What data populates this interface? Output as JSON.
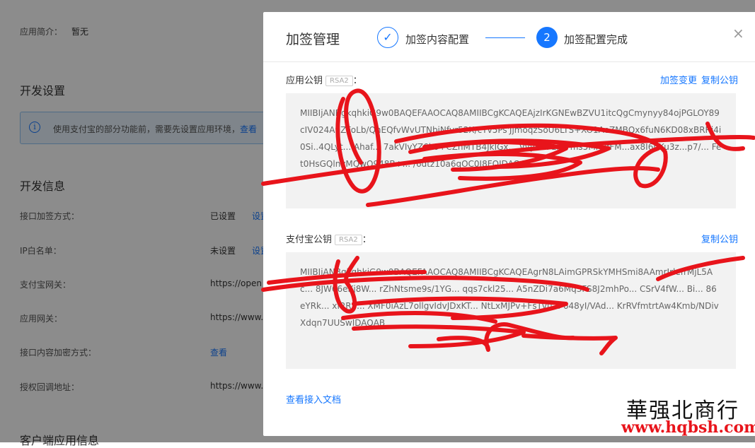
{
  "background": {
    "app_intro_label": "应用简介：",
    "app_intro_value": "暂无",
    "dev_settings_title": "开发设置",
    "notice_text": "使用支付宝的部分功能前，需要先设置应用环境，",
    "notice_link": "查看",
    "dev_info_title": "开发信息",
    "rows": [
      {
        "label": "接口加签方式：",
        "value": "已设置",
        "link": "设置"
      },
      {
        "label": "IP白名单：",
        "value": "未设置",
        "link": "设置"
      },
      {
        "label": "支付宝网关：",
        "value": "https://open"
      },
      {
        "label": "应用网关：",
        "value": "https://www.h"
      },
      {
        "label": "接口内容加密方式：",
        "link": "查看"
      },
      {
        "label": "授权回调地址：",
        "value": "https://www.h"
      }
    ],
    "client_info_title": "客户端应用信息"
  },
  "modal": {
    "title": "加签管理",
    "step1_number": "✓",
    "step1_label": "加签内容配置",
    "step2_number": "2",
    "step2_label": "加签配置完成",
    "close_icon": "×",
    "app_key_label": "应用公钥",
    "app_key_badge": "RSA2",
    "app_key_colon": "：",
    "change_sign_label": "加签变更",
    "copy_app_key_label": "复制公钥",
    "app_public_key": "MIIBIjANBgkqhkiG9w0BAQEFAAOCAQ8AMIIBCgKCAQEAjzIrKGNEwBZVU1itcQgCmynyy84ojPGLOY89cIV024A9ZFoLb/QnEQfvWvUTNbiNfvr52X/cYv5Ps'JjmoqzSoU6LTS+XO1AeZMBQx6fuN6KD08xBRRi4i0Si..4QLyt... Ahaf... 7akVIvYZ6k0+CZhMTB4JkIGx... VyyH... zfCFms5MK9fFM...ax8I6nKu3z...p7/... Fet0HsGQlnvMQwO948B+... /6dtz10a6qOC0J8FQIDAQAB",
    "alipay_key_label": "支付宝公钥",
    "alipay_key_badge": "RSA2",
    "alipay_key_colon": "：",
    "copy_alipay_key_label": "复制公钥",
    "alipay_public_key": "MIIBIjANBgkqhkiG9w0BAQEFAAOCAQ8AMIIBCgKCAQEAgrN8LAimGPRSkYMHSmi8AAmrIrlefrMjL5Ac... 8JW66eKj8W... rZhNtsme9s/1YG... qqs7ckl25... A5nZDi7a6Mq3FS8J2mhPo... CSrV4fW... Bi... 86eYRk... xf2RS... XMF0iAzL7ollgvIdvJDxKT... NtLxMJPv+FsTvu... 648yI/VAd... KrRVfmtrtAw4Kmb/NDivXdqn7UUSwIDAQAB",
    "doc_link": "查看接入文档"
  },
  "watermark": {
    "text_cn": "華强北商行",
    "url": "www.hqbsh.com"
  },
  "colors": {
    "accent": "#1677ff",
    "scribble": "#e8141b",
    "overlay": "rgba(0,0,0,0.45)"
  }
}
